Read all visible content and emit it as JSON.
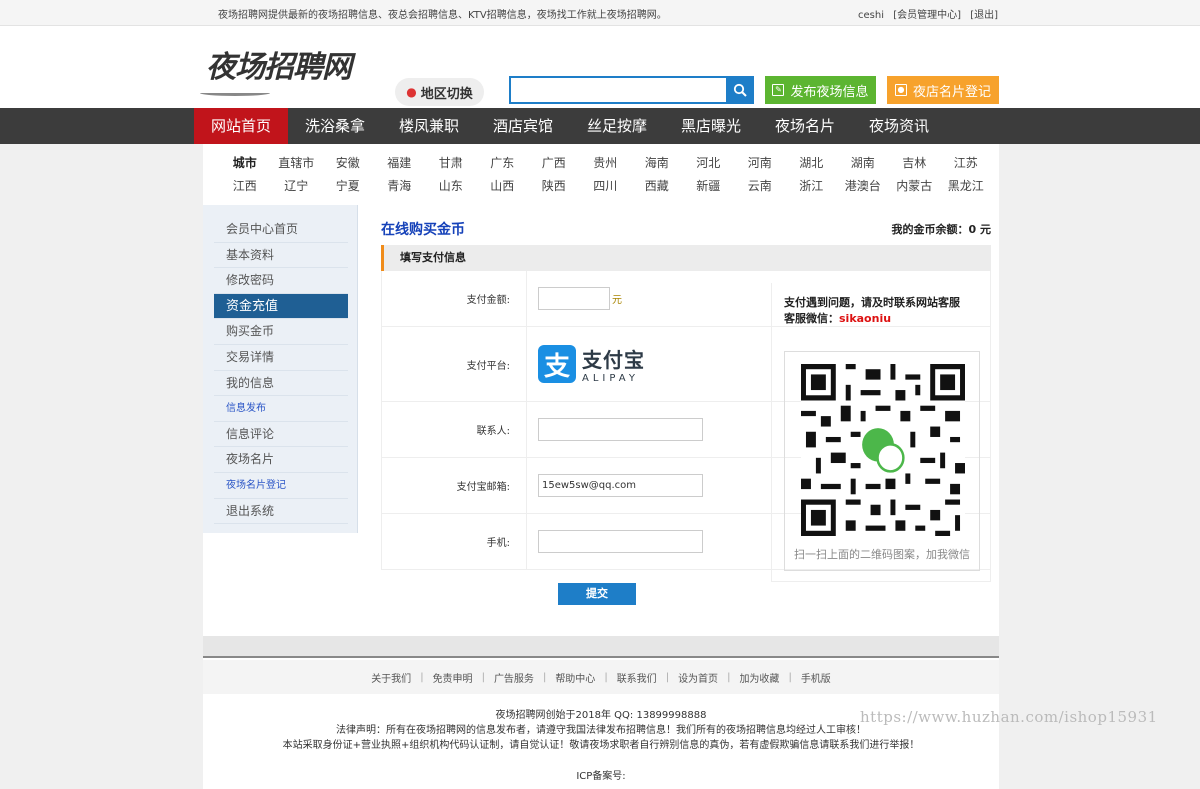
{
  "topbar": {
    "notice": "夜场招聘网提供最新的夜场招聘信息、夜总会招聘信息、KTV招聘信息，夜场找工作就上夜场招聘网。",
    "username": "ceshi",
    "member_center": "[会员管理中心]",
    "logout": "[退出]"
  },
  "header": {
    "logo_text": "夜场招聘网",
    "region_button": "地区切换",
    "search_placeholder": "",
    "post_button": "发布夜场信息",
    "card_button": "夜店名片登记"
  },
  "nav": [
    "网站首页",
    "洗浴桑拿",
    "楼凤兼职",
    "酒店宾馆",
    "丝足按摩",
    "黑店曝光",
    "夜场名片",
    "夜场资讯"
  ],
  "cities": {
    "row1": [
      "城市",
      "直辖市",
      "安徽",
      "福建",
      "甘肃",
      "广东",
      "广西",
      "贵州",
      "海南",
      "河北",
      "河南",
      "湖北",
      "湖南",
      "吉林",
      "江苏"
    ],
    "row2": [
      "江西",
      "辽宁",
      "宁夏",
      "青海",
      "山东",
      "山西",
      "陕西",
      "四川",
      "西藏",
      "新疆",
      "云南",
      "浙江",
      "港澳台",
      "内蒙古",
      "黑龙江"
    ]
  },
  "sidebar": [
    "会员中心首页",
    "基本资料",
    "修改密码",
    "资金充值",
    "购买金币",
    "交易详情",
    "我的信息",
    "信息发布",
    "信息评论",
    "夜场名片",
    "夜场名片登记",
    "退出系统"
  ],
  "content": {
    "title": "在线购买金币",
    "gold_balance": "我的金币余额：0 元",
    "section": "填写支付信息",
    "amount_label": "支付金额:",
    "amount_value": "",
    "amount_unit": "元",
    "platform_label": "支付平台:",
    "alipay_cn": "支付宝",
    "alipay_en": "ALIPAY",
    "contact_label": "联系人:",
    "contact_value": "",
    "email_label": "支付宝邮箱:",
    "email_value": "15ew5sw@qq.com",
    "phone_label": "手机:",
    "phone_value": "",
    "help_line1": "支付遇到问题，请及时联系网站客服",
    "help_wechat_label": "客服微信：",
    "help_wechat": "sikaoniu",
    "qr_caption": "扫一扫上面的二维码图案，加我微信",
    "submit": "提交"
  },
  "footer": {
    "links": [
      "关于我们",
      "免责申明",
      "广告服务",
      "帮助中心",
      "联系我们",
      "设为首页",
      "加为收藏",
      "手机版"
    ],
    "line1": "夜场招聘网创始于2018年 QQ: 13899998888",
    "line2": "法律声明：所有在夜场招聘网的信息发布者，请遵守我国法律发布招聘信息！我们所有的夜场招聘信息均经过人工审核！",
    "line3": "本站采取身份证+营业执照+组织机构代码认证制，请自觉认证！敬请夜场求职者自行辨别信息的真伪，若有虚假欺骗信息请联系我们进行举报！",
    "icp": "ICP备案号:"
  },
  "watermark": "https://www.huzhan.com/ishop15931",
  "colors": {
    "nav_active": "#c1141b",
    "accent_blue": "#1e7ec8",
    "green": "#5cb531",
    "orange": "#f7a22c"
  }
}
